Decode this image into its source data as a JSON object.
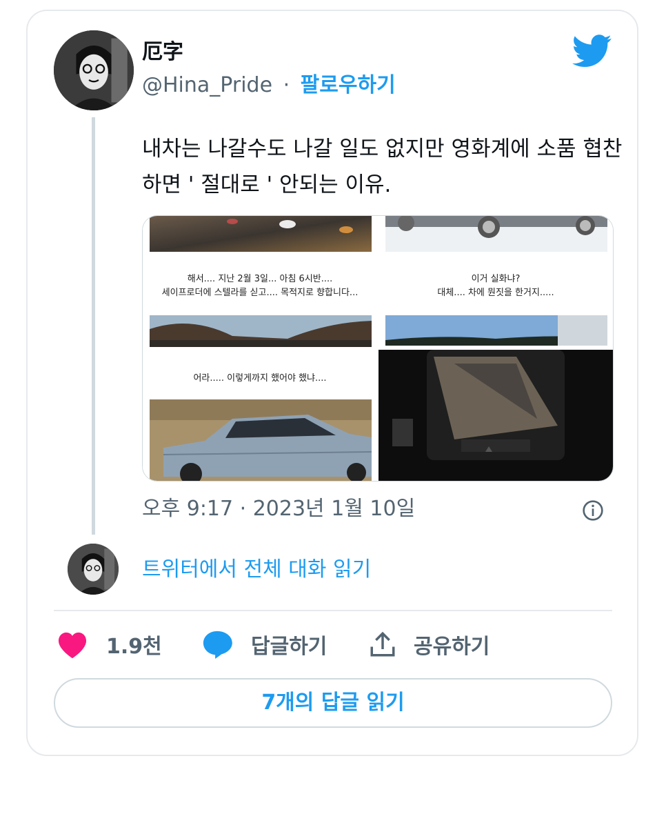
{
  "author": {
    "display_name": "厄字",
    "handle": "@Hina_Pride",
    "separator": "·",
    "follow_label": "팔로우하기"
  },
  "tweet": {
    "text": "내차는 나갈수도 나갈 일도 없지만 영화계에 소품 협찬 하면 ' 절대로 ' 안되는 이유."
  },
  "media": {
    "captions": {
      "top_left_1": "해서.... 지난 2월 3일... 아침 6시반....",
      "top_left_2": "세이프로더에 스텔라를 싣고.... 목적지로 향합니다...",
      "top_right_1": "이거 실화냐?",
      "top_right_2": "대체.... 차에 뭔짓을 한거지.....",
      "bottom_left": "어라..... 이렇게까지 했어야 했냐...."
    }
  },
  "meta": {
    "timestamp": "오후 9:17 · 2023년 1월 10일"
  },
  "thread": {
    "read_conversation": "트위터에서 전체 대화 읽기"
  },
  "actions": {
    "like_count": "1.9천",
    "reply_label": "답글하기",
    "share_label": "공유하기"
  },
  "replies_button": "7개의 답글 읽기",
  "colors": {
    "accent": "#1d9bf0",
    "like": "#f91880",
    "secondary_text": "#536471",
    "border": "#cfd9de"
  },
  "icons": [
    "twitter-bird-icon",
    "info-icon",
    "heart-icon",
    "reply-bubble-icon",
    "share-icon"
  ]
}
